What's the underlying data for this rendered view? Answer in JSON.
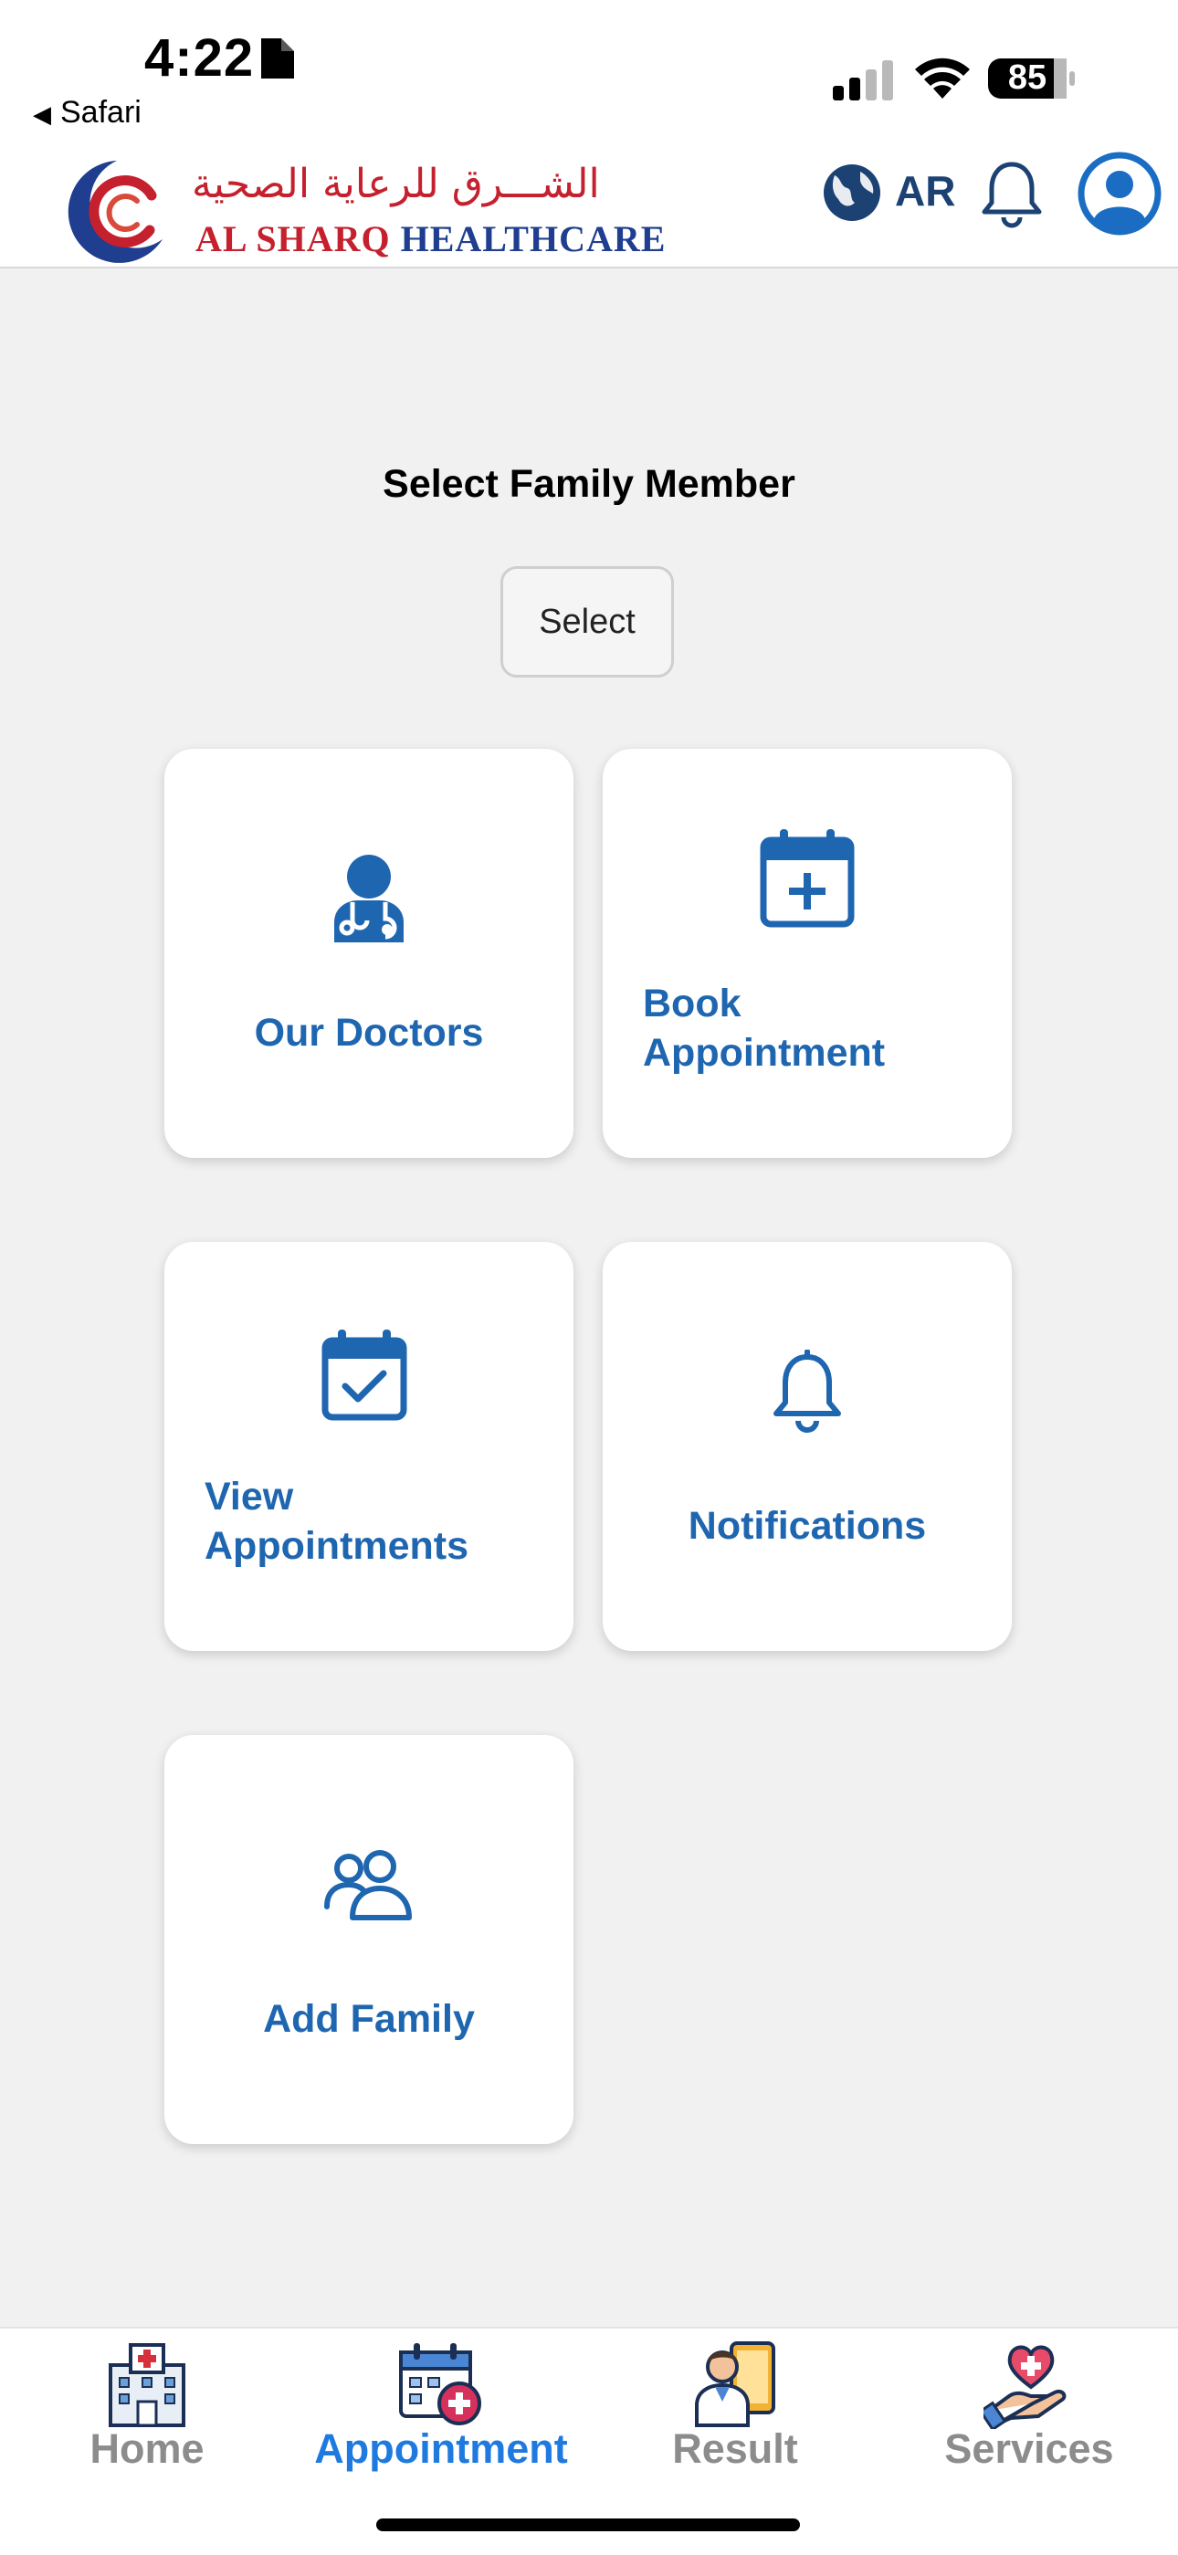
{
  "status_bar": {
    "time": "4:22",
    "back_label": "Safari",
    "battery": "85"
  },
  "header": {
    "logo_arabic": "الشـــرق للرعاية الصحية",
    "logo_en_part1": "AL SHARQ",
    "logo_en_part2": "HEALTHCARE",
    "language": "AR",
    "colors": {
      "brand_red": "#c5202e",
      "brand_blue": "#1f3e8f"
    }
  },
  "main": {
    "title": "Select Family Member",
    "select_label": "Select",
    "tiles": [
      {
        "label": "Our Doctors",
        "icon": "doctor-icon"
      },
      {
        "label_line1": "Book",
        "label_line2": "Appointment",
        "icon": "calendar-plus-icon"
      },
      {
        "label_line1": "View",
        "label_line2": "Appointments",
        "icon": "calendar-check-icon"
      },
      {
        "label": "Notifications",
        "icon": "bell-icon"
      },
      {
        "label": "Add Family",
        "icon": "users-icon"
      }
    ],
    "colors": {
      "accent": "#1f66b0"
    }
  },
  "bottom_nav": {
    "items": [
      {
        "label": "Home",
        "icon": "hospital-icon"
      },
      {
        "label": "Appointment",
        "icon": "appointment-calendar-icon",
        "active": true
      },
      {
        "label": "Result",
        "icon": "doctor-phone-icon"
      },
      {
        "label": "Services",
        "icon": "heart-hand-icon"
      }
    ],
    "colors": {
      "active": "#1f7ae0",
      "inactive": "#8c8c8c"
    }
  }
}
